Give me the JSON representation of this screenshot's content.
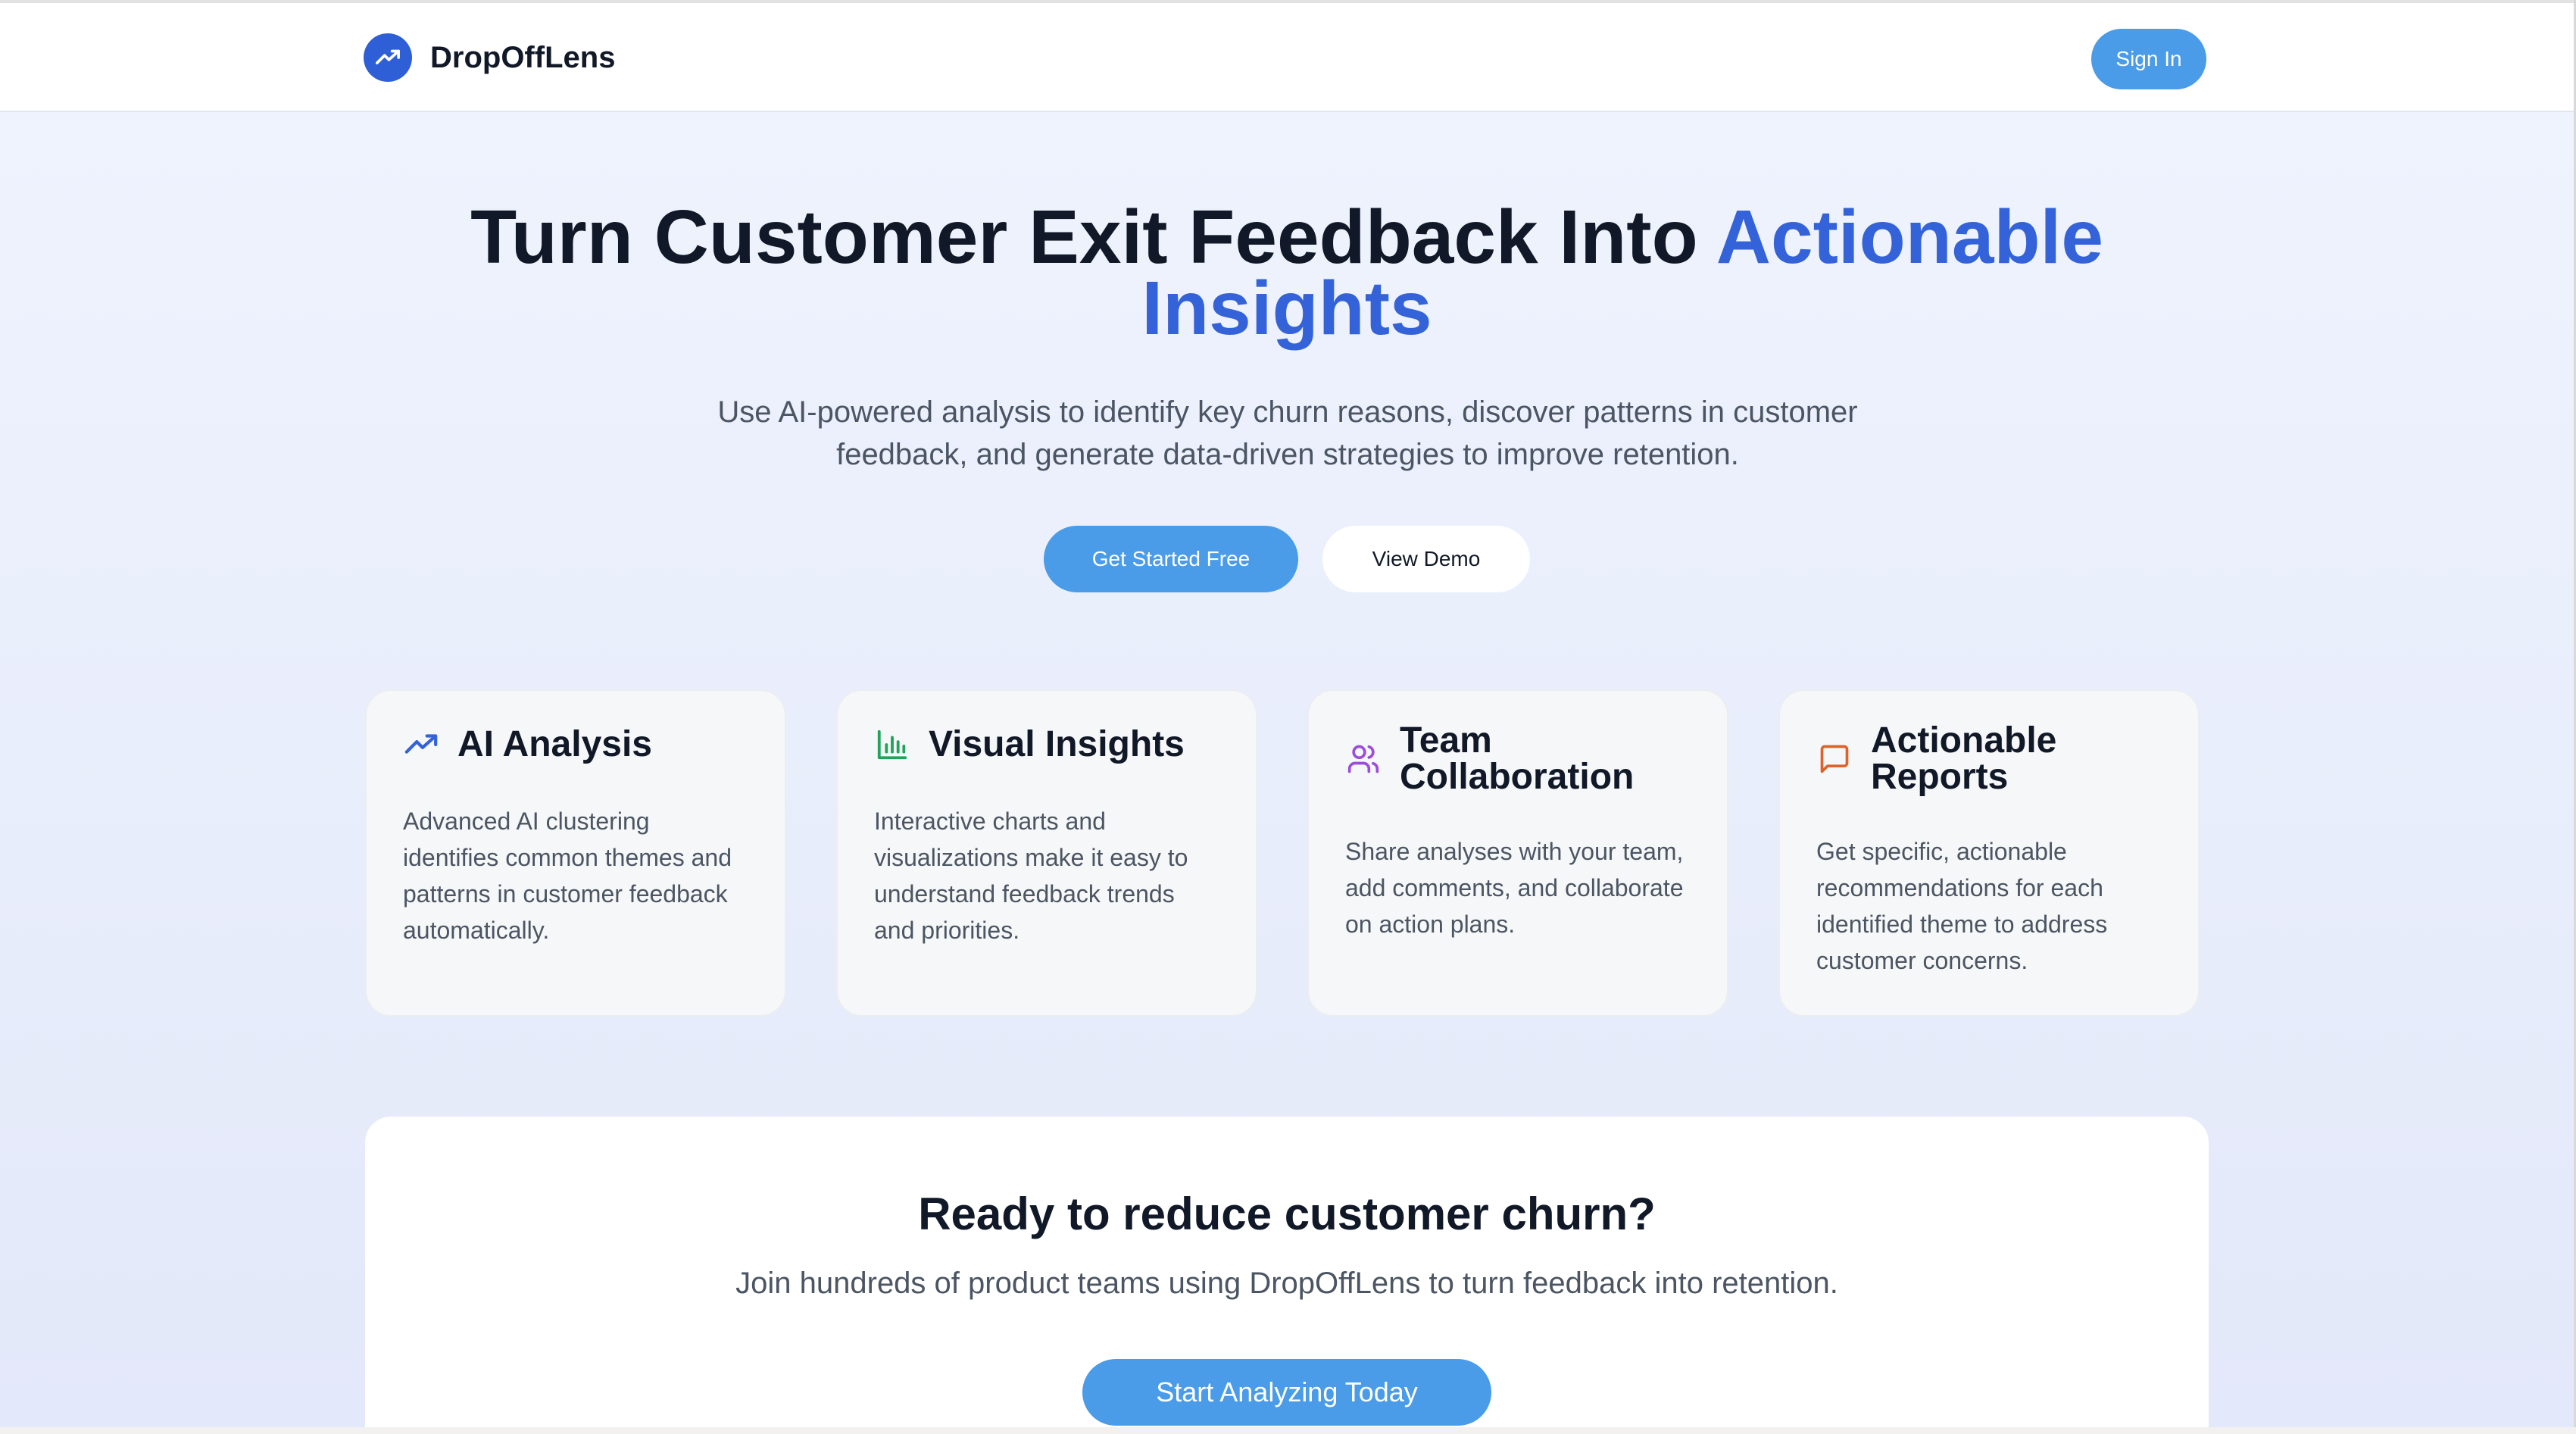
{
  "header": {
    "brand_name": "DropOffLens",
    "brand_icon": "trending-up-icon",
    "sign_in_label": "Sign In"
  },
  "hero": {
    "title_part1": "Turn Customer Exit Feedback Into ",
    "title_accent_line1": "Actionable",
    "title_accent_line2": "Insights",
    "subtitle": "Use AI-powered analysis to identify key churn reasons, discover patterns in customer feedback, and generate data-driven strategies to improve retention.",
    "primary_button": "Get Started Free",
    "secondary_button": "View Demo"
  },
  "features": [
    {
      "icon": "trending-up-icon",
      "icon_color": "#3462d8",
      "title": "AI Analysis",
      "text": "Advanced AI clustering identifies common themes and patterns in customer feedback automatically."
    },
    {
      "icon": "bar-chart-icon",
      "icon_color": "#22a35a",
      "title": "Visual Insights",
      "text": "Interactive charts and visualizations make it easy to understand feedback trends and priorities."
    },
    {
      "icon": "users-icon",
      "icon_color": "#9b4ddb",
      "title": "Team Collaboration",
      "text": "Share analyses with your team, add comments, and collaborate on action plans."
    },
    {
      "icon": "message-square-icon",
      "icon_color": "#e0622b",
      "title": "Actionable Reports",
      "text": "Get specific, actionable recommendations for each identified theme to address customer concerns."
    }
  ],
  "cta": {
    "title": "Ready to reduce customer churn?",
    "subtitle": "Join hundreds of product teams using DropOffLens to turn feedback into retention.",
    "button": "Start Analyzing Today"
  },
  "colors": {
    "accent": "#3462d8",
    "button": "#4a9be8",
    "text_dark": "#111827",
    "text_muted": "#4b5563"
  }
}
